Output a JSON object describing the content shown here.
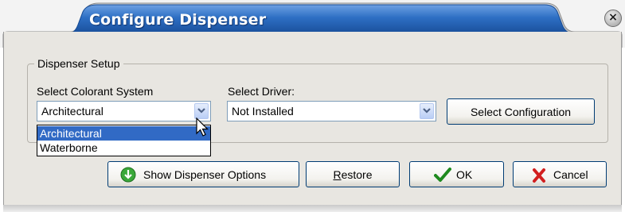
{
  "window": {
    "title": "Configure Dispenser",
    "close_glyph": "×",
    "colors": {
      "title_bar": "#1d5fb2",
      "title_bar_light": "#6fa1e3",
      "panel": "#e8e6e1"
    }
  },
  "group": {
    "legend": "Dispenser Setup"
  },
  "colorant": {
    "label": "Select Colorant System",
    "value": "Architectural",
    "open": true,
    "options": [
      "Architectural",
      "Waterborne"
    ],
    "highlighted": "Architectural"
  },
  "driver": {
    "label": "Select Driver:",
    "value": "Not Installed"
  },
  "buttons": {
    "select_configuration": "Select Configuration",
    "show_options": "Show Dispenser Options",
    "restore_prefix": "",
    "restore_mnemonic": "R",
    "restore_rest": "estore",
    "ok": "OK",
    "cancel": "Cancel"
  },
  "icons": {
    "show_options": "green-down-arrow-icon",
    "ok": "green-checkmark-icon",
    "cancel": "red-x-icon",
    "combo": "chevron-down-icon",
    "pointer": "mouse-pointer-icon"
  }
}
